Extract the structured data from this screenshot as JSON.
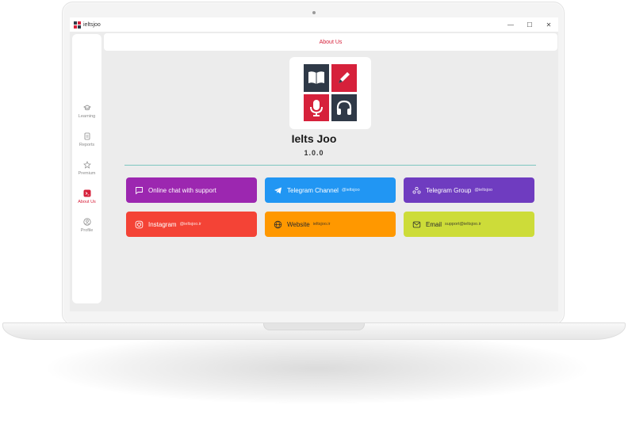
{
  "window": {
    "app_name": "ieltsjoo",
    "minimize_glyph": "—",
    "maximize_glyph": "☐",
    "close_glyph": "✕"
  },
  "sidebar": {
    "items": [
      {
        "label": "Learning",
        "icon": "graduation-cap-icon",
        "active": false
      },
      {
        "label": "Reports",
        "icon": "report-icon",
        "active": false
      },
      {
        "label": "Premium",
        "icon": "premium-icon",
        "active": false
      },
      {
        "label": "About Us",
        "icon": "about-icon",
        "active": true
      },
      {
        "label": "Profile",
        "icon": "profile-icon",
        "active": false
      }
    ]
  },
  "header": {
    "title": "About Us"
  },
  "about": {
    "title": "Ielts Joo",
    "version": "1.0.0"
  },
  "contacts": [
    {
      "label": "Online chat with support",
      "handle": "",
      "icon": "chat-icon",
      "color": "#9c27b0"
    },
    {
      "label": "Telegram Channel",
      "handle": "@ieltsjoo",
      "icon": "telegram-icon",
      "color": "#2196f3"
    },
    {
      "label": "Telegram Group",
      "handle": "@ieltsjoo",
      "icon": "group-icon",
      "color": "#6f3cc0"
    },
    {
      "label": "Instagram",
      "handle": "@ieltsjoo.ir",
      "icon": "instagram-icon",
      "color": "#f44336"
    },
    {
      "label": "Website",
      "handle": "ieltsjoo.ir",
      "icon": "globe-icon",
      "color": "#ff9800"
    },
    {
      "label": "Email",
      "handle": "support@ieltsjoo.ir",
      "icon": "mail-icon",
      "color": "#cddc39"
    }
  ],
  "colors": {
    "accent": "#d6213b",
    "logo_dark": "#2f3947",
    "divider": "#7ec6c0"
  }
}
